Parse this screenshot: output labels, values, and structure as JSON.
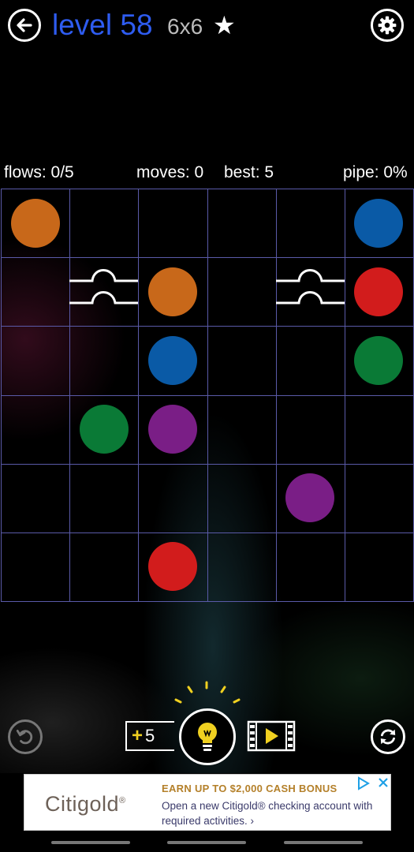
{
  "header": {
    "title": "level 58",
    "grid_size": "6x6",
    "star": "★"
  },
  "stats": {
    "flows": "flows: 0/5",
    "moves": "moves: 0",
    "best": "best: 5",
    "pipe": "pipe: 0%"
  },
  "board": {
    "rows": 6,
    "cols": 6,
    "dots": [
      {
        "color": "orange",
        "row": 0,
        "col": 0
      },
      {
        "color": "blue",
        "row": 0,
        "col": 5
      },
      {
        "color": "orange",
        "row": 1,
        "col": 2
      },
      {
        "color": "red",
        "row": 1,
        "col": 5
      },
      {
        "color": "blue",
        "row": 2,
        "col": 2
      },
      {
        "color": "green",
        "row": 2,
        "col": 5
      },
      {
        "color": "green",
        "row": 3,
        "col": 1
      },
      {
        "color": "purple",
        "row": 3,
        "col": 2
      },
      {
        "color": "purple",
        "row": 4,
        "col": 4
      },
      {
        "color": "red",
        "row": 5,
        "col": 2
      }
    ],
    "bridges": [
      {
        "row": 1,
        "col": 1
      },
      {
        "row": 1,
        "col": 4
      }
    ]
  },
  "colors": {
    "orange": "#c8681a",
    "blue": "#0a5aa6",
    "red": "#d21c1c",
    "green": "#0a7a36",
    "purple": "#7a1e86",
    "grid": "#5a5aa8",
    "title": "#2e5cf0",
    "hint": "#f0d020"
  },
  "controls": {
    "hint_count_prefix": "+",
    "hint_count": "5"
  },
  "icons": {
    "back": "arrow-left-icon",
    "settings": "gear-icon",
    "undo": "undo-icon",
    "restart": "refresh-icon",
    "hint": "lightbulb-icon",
    "video": "video-play-icon"
  },
  "ad": {
    "logo": "Citigold",
    "logo_mark": "®",
    "headline": "EARN UP TO $2,000 CASH BONUS",
    "body": "Open a new Citigold® checking account with required activities. ›"
  }
}
